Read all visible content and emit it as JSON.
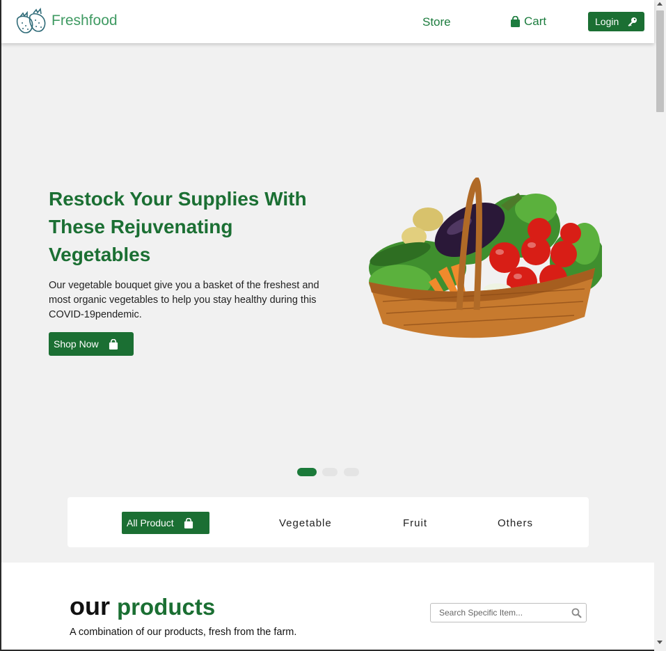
{
  "navbar": {
    "brand": "Freshfood",
    "links": {
      "store": "Store",
      "cart": "Cart"
    },
    "login_label": "Login"
  },
  "hero": {
    "title": "Restock Your Supplies With These Rejuvenating Vegetables",
    "description": "Our vegetable bouquet give you a basket of the freshest and most organic vegetables to help you stay healthy during this COVID-19pendemic.",
    "cta_label": "Shop Now",
    "image_icon": "vegetable-basket",
    "slides_total": 3,
    "active_slide": 1
  },
  "categories": {
    "all": "All Product",
    "vegetable": "Vegetable",
    "fruit": "Fruit",
    "others": "Others"
  },
  "products": {
    "title_plain": "our",
    "title_accent": "products",
    "subtitle": "A combination of our products, fresh from the farm.",
    "search_placeholder": "Search Specific Item..."
  },
  "colors": {
    "primary": "#1b6f33",
    "brand_text": "#3f9a62",
    "background": "#f1f1f1"
  },
  "icons": [
    "strawberry-logo-icon",
    "shopping-bag-icon",
    "key-icon",
    "search-icon"
  ]
}
